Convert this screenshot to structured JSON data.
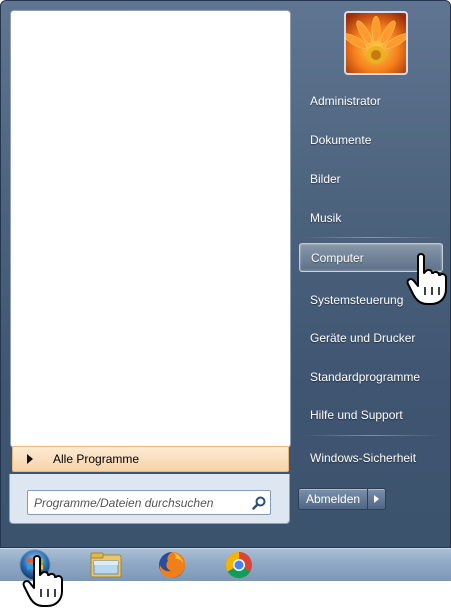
{
  "left_pane": {
    "all_programs_label": "Alle Programme",
    "search_placeholder": "Programme/Dateien durchsuchen"
  },
  "right_pane": {
    "items": [
      {
        "label": "Administrator"
      },
      {
        "label": "Dokumente"
      },
      {
        "label": "Bilder"
      },
      {
        "label": "Musik"
      },
      {
        "label": "Computer",
        "selected": true
      },
      {
        "label": "Systemsteuerung"
      },
      {
        "label": "Geräte und Drucker"
      },
      {
        "label": "Standardprogramme"
      },
      {
        "label": "Hilfe und Support"
      },
      {
        "label": "Windows-Sicherheit"
      }
    ],
    "shutdown_label": "Abmelden"
  },
  "taskbar": {
    "icons": [
      "start-orb-icon",
      "explorer-folder-icon",
      "firefox-icon",
      "chrome-icon"
    ]
  },
  "colors": {
    "menu_background": "#4d647f",
    "all_programs_highlight": "#f7d3a7",
    "taskbar": "#8fa9c5"
  }
}
